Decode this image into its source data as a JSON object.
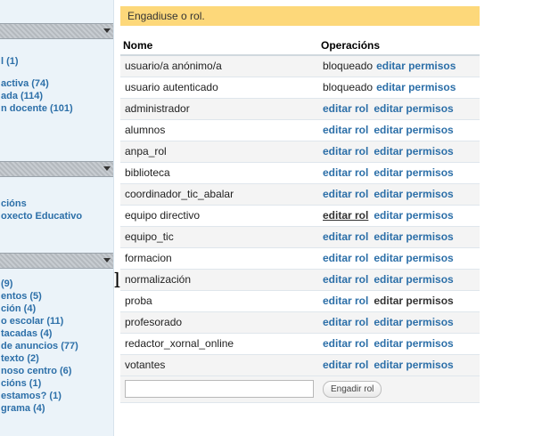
{
  "sidebar": {
    "block1": {
      "items": [
        {
          "label": "l (1)"
        },
        {
          "label": "activa (74)"
        },
        {
          "label": "ada (114)"
        },
        {
          "label": "n docente (101)"
        }
      ]
    },
    "block2": {
      "items": [
        {
          "label": "cións"
        },
        {
          "label": "oxecto Educativo"
        }
      ]
    },
    "block3": {
      "items": [
        {
          "label": "(9)"
        },
        {
          "label": "entos (5)"
        },
        {
          "label": "ción (4)"
        },
        {
          "label": "o escolar (11)"
        },
        {
          "label": "tacadas (4)"
        },
        {
          "label": "de anuncios (77)"
        },
        {
          "label": "texto (2)"
        },
        {
          "label": "noso centro (6)"
        },
        {
          "label": "cións (1)"
        },
        {
          "label": "estamos? (1)"
        },
        {
          "label": "grama (4)"
        }
      ]
    }
  },
  "stray_glyph": "l",
  "status_message": "Engadiuse o rol.",
  "table": {
    "headers": {
      "name": "Nome",
      "operations": "Operacións"
    },
    "rows": [
      {
        "name": "usuario/a anónimo/a",
        "op1": "bloqueado",
        "op2": "editar permisos"
      },
      {
        "name": "usuario autenticado",
        "op1": "bloqueado",
        "op2": "editar permisos"
      },
      {
        "name": "administrador",
        "op1": "editar rol",
        "op2": "editar permisos"
      },
      {
        "name": "alumnos",
        "op1": "editar rol",
        "op2": "editar permisos"
      },
      {
        "name": "anpa_rol",
        "op1": "editar rol",
        "op2": "editar permisos"
      },
      {
        "name": "biblioteca",
        "op1": "editar rol",
        "op2": "editar permisos"
      },
      {
        "name": "coordinador_tic_abalar",
        "op1": "editar rol",
        "op2": "editar permisos"
      },
      {
        "name": "equipo directivo",
        "op1": "editar rol",
        "op2": "editar permisos"
      },
      {
        "name": "equipo_tic",
        "op1": "editar rol",
        "op2": "editar permisos"
      },
      {
        "name": "formacion",
        "op1": "editar rol",
        "op2": "editar permisos"
      },
      {
        "name": "normalización",
        "op1": "editar rol",
        "op2": "editar permisos"
      },
      {
        "name": "proba",
        "op1": "editar rol",
        "op2": "editar permisos"
      },
      {
        "name": "profesorado",
        "op1": "editar rol",
        "op2": "editar permisos"
      },
      {
        "name": "redactor_xornal_online",
        "op1": "editar rol",
        "op2": "editar permisos"
      },
      {
        "name": "votantes",
        "op1": "editar rol",
        "op2": "editar permisos"
      }
    ],
    "new_role_value": "",
    "add_button": "Engadir rol"
  },
  "colors": {
    "link": "#2c6fa8",
    "status_bg": "#fdd87a",
    "sidebar_bg": "#ebf3f9"
  }
}
